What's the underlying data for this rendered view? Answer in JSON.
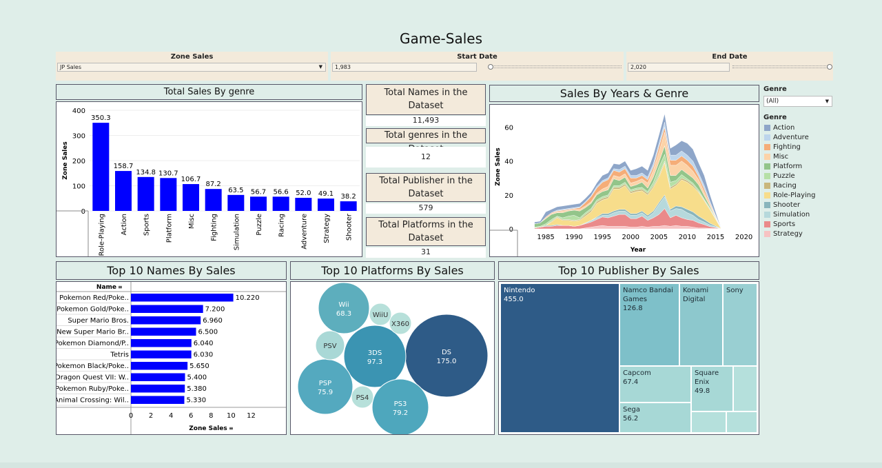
{
  "title": "Game-Sales",
  "filters": {
    "zone": {
      "label": "Zone Sales",
      "value": "JP Sales"
    },
    "start": {
      "label": "Start Date",
      "value": "1,983"
    },
    "end": {
      "label": "End Date",
      "value": "2,020"
    }
  },
  "kpis": [
    {
      "label": "Total Names in the Dataset",
      "value": "11,493"
    },
    {
      "label": "Total genres in the Dataset",
      "value": "12"
    },
    {
      "label": "Total Publisher in the Dataset",
      "value": "579"
    },
    {
      "label": "Total Platforms in the Dataset",
      "value": "31"
    }
  ],
  "genre_filter": {
    "label": "Genre",
    "value": "(All)",
    "legend_title": "Genre"
  },
  "colors": {
    "bar": "#0000ff",
    "genres": {
      "Action": "#8ea6c9",
      "Adventure": "#bdd5ec",
      "Fighting": "#f5ad78",
      "Misc": "#fcd3a8",
      "Platform": "#93c58a",
      "Puzzle": "#b6e0a6",
      "Racing": "#c9b77c",
      "Role-Playing": "#f7dd8b",
      "Shooter": "#89b5bc",
      "Simulation": "#b6d9dc",
      "Sports": "#ea8a8a",
      "Strategy": "#f7c3c3"
    }
  },
  "chart_data": [
    {
      "type": "bar",
      "title": "Total Sales By genre",
      "ylabel": "Zone Sales",
      "ylim": [
        0,
        400
      ],
      "yticks": [
        "0",
        "100",
        "200",
        "300",
        "400"
      ],
      "categories": [
        "Role-Playing",
        "Action",
        "Sports",
        "Platform",
        "Misc",
        "Fighting",
        "Simulation",
        "Puzzle",
        "Racing",
        "Adventure",
        "Strategy",
        "Shooter"
      ],
      "values": [
        350.3,
        158.7,
        134.8,
        130.7,
        106.7,
        87.2,
        63.5,
        56.7,
        56.6,
        52.0,
        49.1,
        38.2
      ],
      "labels": [
        "350.3",
        "158.7",
        "134.8",
        "130.7",
        "106.7",
        "87.2",
        "63.5",
        "56.7",
        "56.6",
        "52.0",
        "49.1",
        "38.2"
      ]
    },
    {
      "type": "area",
      "title": "Sales By Years & Genre",
      "xlabel": "Year",
      "ylabel": "Zone Sales",
      "xticks": [
        "1985",
        "1990",
        "1995",
        "2000",
        "2005",
        "2010",
        "2015",
        "2020"
      ],
      "yticks": [
        "0",
        "20",
        "40",
        "60"
      ],
      "xlim": [
        1980,
        2022
      ],
      "ylim": [
        0,
        70
      ],
      "x": [
        1983,
        1984,
        1985,
        1986,
        1987,
        1988,
        1989,
        1990,
        1991,
        1992,
        1993,
        1994,
        1995,
        1996,
        1997,
        1998,
        1999,
        2000,
        2001,
        2002,
        2003,
        2004,
        2005,
        2006,
        2007,
        2008,
        2009,
        2010,
        2011,
        2012,
        2013,
        2014,
        2015,
        2016
      ],
      "series": [
        {
          "name": "Strategy",
          "values": [
            0,
            0,
            0,
            0,
            0,
            0,
            0,
            0,
            0,
            0.5,
            1,
            1.5,
            2,
            1.5,
            1.5,
            1.5,
            1.5,
            1,
            1,
            1.5,
            1,
            1.5,
            1.5,
            2,
            1.5,
            2,
            1.5,
            1.5,
            1,
            0.5,
            0.5,
            0.3,
            0.2,
            0
          ]
        },
        {
          "name": "Sports",
          "values": [
            0.5,
            1,
            1.5,
            1.5,
            2,
            2,
            2,
            1.5,
            2,
            2.5,
            3,
            4,
            5,
            5,
            6,
            7,
            7,
            5,
            5,
            6,
            4,
            5,
            7,
            10,
            5,
            6,
            5,
            4,
            4,
            3,
            2,
            1,
            0.5,
            0
          ]
        },
        {
          "name": "Simulation",
          "values": [
            0,
            0,
            0,
            0,
            0,
            0,
            0,
            0,
            0,
            0.5,
            1,
            1,
            1,
            1.5,
            2,
            2,
            2,
            2,
            2,
            2,
            2,
            3,
            6,
            7,
            4,
            4,
            5,
            4,
            3,
            2,
            1.5,
            1,
            0.5,
            0
          ]
        },
        {
          "name": "Shooter",
          "values": [
            0,
            0,
            0.5,
            0.5,
            0.5,
            0,
            0,
            0,
            0,
            0,
            0,
            0.5,
            1,
            1,
            1,
            1,
            1,
            1,
            1,
            1,
            1,
            1,
            1,
            1,
            1,
            1.5,
            1.5,
            2,
            2,
            2,
            1.5,
            1,
            0.5,
            0
          ]
        },
        {
          "name": "Role-Playing",
          "values": [
            0,
            0,
            0,
            2,
            4,
            3,
            3,
            3,
            3,
            4,
            5,
            8,
            8,
            9,
            13,
            12,
            14,
            12,
            13,
            12,
            12,
            14,
            15,
            19,
            12,
            12,
            16,
            16,
            15,
            14,
            11,
            8,
            4,
            0
          ]
        },
        {
          "name": "Racing",
          "values": [
            0,
            0,
            0,
            0.5,
            0.5,
            0.5,
            0.5,
            0.5,
            0.5,
            1,
            1,
            1,
            1,
            1,
            1,
            1,
            1,
            1,
            1,
            1,
            1,
            1,
            1,
            1,
            1,
            1,
            1,
            1,
            1,
            0.5,
            0.5,
            0.5,
            0.2,
            0
          ]
        },
        {
          "name": "Puzzle",
          "values": [
            0.5,
            0.5,
            1,
            1,
            0.5,
            1,
            2,
            3,
            1,
            1,
            1,
            1,
            1,
            1,
            1,
            1,
            1,
            1,
            1,
            1,
            1,
            2,
            5,
            4,
            3,
            2,
            2,
            1,
            1,
            1,
            0.5,
            0.5,
            0.2,
            0
          ]
        },
        {
          "name": "Platform",
          "values": [
            2,
            2,
            3,
            3,
            2,
            3,
            3,
            3,
            4,
            3,
            3,
            3,
            3,
            3,
            4,
            3,
            3,
            2,
            2,
            3,
            2,
            3,
            3,
            5,
            4,
            3,
            3,
            3,
            3,
            3,
            2,
            1,
            0.5,
            0
          ]
        },
        {
          "name": "Misc",
          "values": [
            0,
            0,
            0.5,
            0.5,
            0.5,
            1,
            0.5,
            0.5,
            1,
            1,
            1,
            1,
            1.5,
            2,
            2,
            2,
            2,
            2,
            2,
            2,
            3,
            4,
            6,
            8,
            6,
            6,
            5,
            5,
            4,
            3,
            2,
            1,
            0.5,
            0
          ]
        },
        {
          "name": "Fighting",
          "values": [
            0,
            0,
            0.5,
            0.5,
            0.5,
            0.5,
            0.5,
            0.5,
            1,
            2,
            3,
            3,
            4,
            4,
            3,
            3,
            3,
            3,
            2,
            2,
            2,
            2,
            3,
            3,
            3,
            3,
            3,
            3,
            3,
            2,
            2,
            1,
            0.5,
            0
          ]
        },
        {
          "name": "Adventure",
          "values": [
            0,
            0,
            0,
            0,
            0.5,
            0.5,
            0.5,
            0.5,
            0.5,
            0.5,
            0.5,
            1,
            1,
            1,
            1,
            1.5,
            1.5,
            1.5,
            1.5,
            1.5,
            1.5,
            2,
            2,
            3,
            3,
            3,
            3,
            3,
            3,
            2,
            2,
            1,
            0.5,
            0
          ]
        },
        {
          "name": "Action",
          "values": [
            1,
            1,
            3,
            2,
            2,
            2,
            2,
            2,
            2,
            2,
            2,
            2,
            3,
            3,
            3,
            3,
            3,
            3,
            4,
            4,
            4,
            5,
            5,
            5,
            4,
            6,
            6,
            7,
            7,
            6,
            6,
            4,
            2,
            0
          ]
        }
      ]
    },
    {
      "type": "bar",
      "title": "Top 10 Names By Sales",
      "column_header": "Name",
      "xlabel": "Zone Sales",
      "xlim": [
        0,
        13
      ],
      "xticks": [
        "0",
        "2",
        "4",
        "6",
        "8",
        "10",
        "12"
      ],
      "categories": [
        "Pokemon Red/Poke..",
        "Pokemon Gold/Poke..",
        "Super Mario Bros.",
        "New Super Mario Br..",
        "Pokemon Diamond/P..",
        "Tetris",
        "Pokemon Black/Poke..",
        "Dragon Quest VII: W..",
        "Pokemon Ruby/Poke..",
        "Animal Crossing: Wil.."
      ],
      "values": [
        10.22,
        7.2,
        6.96,
        6.5,
        6.04,
        6.03,
        5.65,
        5.4,
        5.38,
        5.33
      ],
      "labels": [
        "10.220",
        "7.200",
        "6.960",
        "6.500",
        "6.040",
        "6.030",
        "5.650",
        "5.400",
        "5.380",
        "5.330"
      ]
    },
    {
      "type": "scatter",
      "title": "Top 10 Platforms By Sales",
      "bubbles": [
        {
          "name": "DS",
          "label": "175.0",
          "value": 175.0,
          "color": "#2e5b87"
        },
        {
          "name": "3DS",
          "label": "97.3",
          "value": 97.3,
          "color": "#3b94b2"
        },
        {
          "name": "PS3",
          "label": "79.2",
          "value": 79.2,
          "color": "#4ea7bd"
        },
        {
          "name": "PSP",
          "label": "75.9",
          "value": 75.9,
          "color": "#54a9bf"
        },
        {
          "name": "Wii",
          "label": "68.3",
          "value": 68.3,
          "color": "#5daebd"
        },
        {
          "name": "PSV",
          "label": "",
          "color": "#a9d8d6"
        },
        {
          "name": "WiiU",
          "label": "",
          "color": "#b7e0da"
        },
        {
          "name": "X360",
          "label": "",
          "color": "#b7e0da"
        },
        {
          "name": "PS4",
          "label": "",
          "color": "#b7e0da"
        }
      ]
    },
    {
      "type": "heatmap",
      "title": "Top 10 Publisher By Sales",
      "tiles": [
        {
          "name": "Nintendo",
          "label": "455.0",
          "value": 455.0
        },
        {
          "name": "Namco Bandai Games",
          "label": "126.8",
          "value": 126.8
        },
        {
          "name": "Konami Digital",
          "label": ""
        },
        {
          "name": "Sony",
          "label": ""
        },
        {
          "name": "Capcom",
          "label": "67.4",
          "value": 67.4
        },
        {
          "name": "Square Enix",
          "label": "49.8",
          "value": 49.8
        },
        {
          "name": "Sega",
          "label": "56.2",
          "value": 56.2
        }
      ]
    }
  ]
}
